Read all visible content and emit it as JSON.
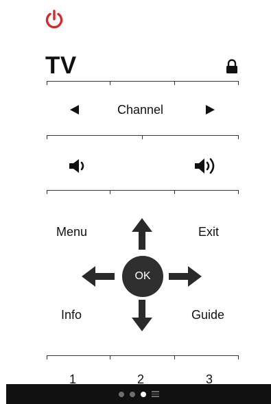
{
  "header": {
    "power_icon": "power-icon",
    "power_color": "#d12b2b",
    "title": "TV",
    "lock_icon": "lock-icon"
  },
  "channel_row": {
    "label": "Channel",
    "left_icon": "triangle-left-icon",
    "right_icon": "triangle-right-icon"
  },
  "volume_row": {
    "down_icon": "volume-down-icon",
    "up_icon": "volume-up-icon"
  },
  "dpad": {
    "menu_label": "Menu",
    "exit_label": "Exit",
    "info_label": "Info",
    "guide_label": "Guide",
    "ok_label": "OK",
    "up_icon": "arrow-up-icon",
    "down_icon": "arrow-down-icon",
    "left_icon": "arrow-left-icon",
    "right_icon": "arrow-right-icon"
  },
  "number_row": {
    "keys": [
      "1",
      "2",
      "3"
    ]
  },
  "page_indicator": {
    "pages": 4,
    "active_index": 2,
    "last_icon": "menu-lines-icon"
  }
}
